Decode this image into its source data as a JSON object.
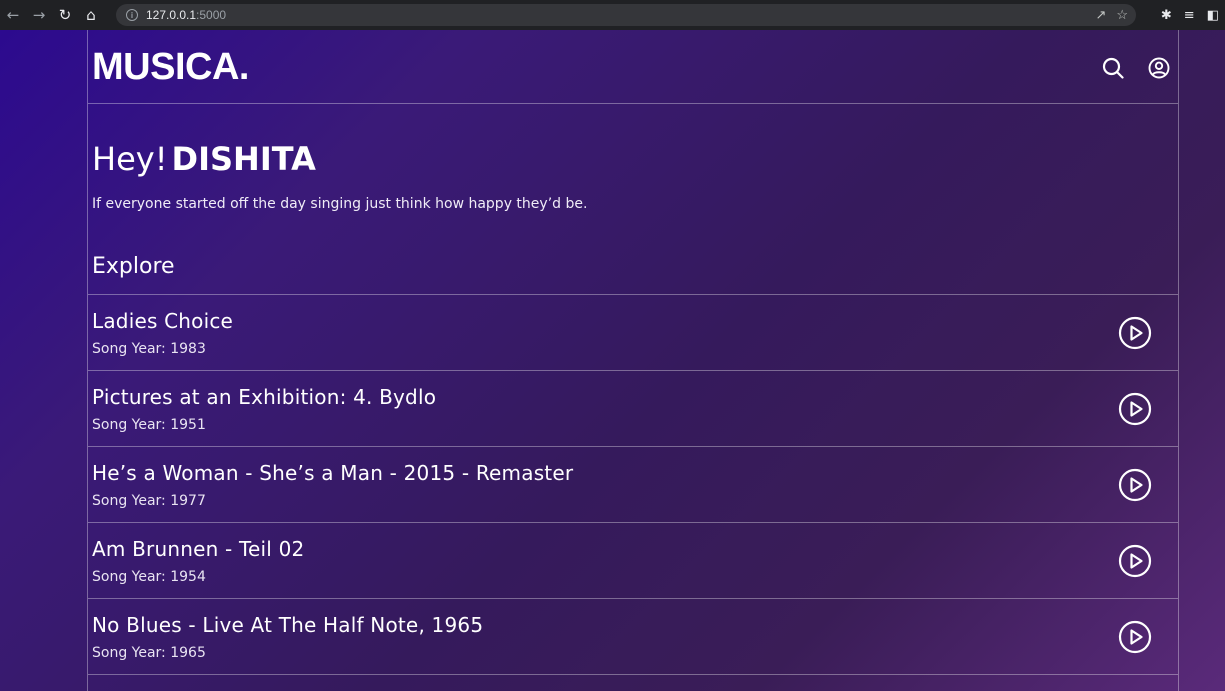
{
  "browser": {
    "url_host": "127.0.0.1",
    "url_port": ":5000"
  },
  "header": {
    "logo": "MUSICA."
  },
  "greeting": {
    "hey": "Hey!",
    "name": "DISHITA",
    "tagline": "If everyone started off the day singing just think how happy they’d be."
  },
  "explore": {
    "title": "Explore",
    "year_label": "Song Year:",
    "songs": [
      {
        "title": "Ladies Choice",
        "year": "1983"
      },
      {
        "title": "Pictures at an Exhibition: 4. Bydlo",
        "year": "1951"
      },
      {
        "title": "He’s a Woman - She’s a Man - 2015 - Remaster",
        "year": "1977"
      },
      {
        "title": "Am Brunnen - Teil 02",
        "year": "1954"
      },
      {
        "title": "No Blues - Live At The Half Note, 1965",
        "year": "1965"
      }
    ]
  },
  "colors": {
    "bg_start": "#2c0a8f",
    "bg_end": "#5a2a7a",
    "text": "#ffffff"
  }
}
